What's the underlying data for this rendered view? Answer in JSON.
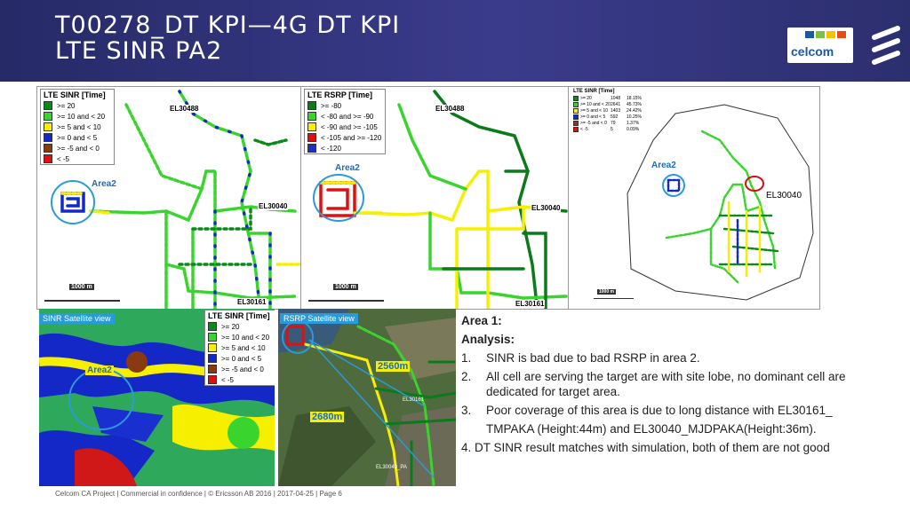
{
  "header": {
    "title_line1": "T00278_DT KPI—4G DT KPI",
    "title_line2": "LTE SINR PA2",
    "celcom_logo_text": "celcom"
  },
  "panel_sinr": {
    "legend_title": "LTE SINR [Time]",
    "legend": [
      {
        "label": ">= 20",
        "color": "#0a8a1a"
      },
      {
        "label": ">= 10 and < 20",
        "color": "#39d42e"
      },
      {
        "label": ">= 5 and < 10",
        "color": "#f6f000"
      },
      {
        "label": ">= 0 and < 5",
        "color": "#1428c8"
      },
      {
        "label": ">= -5 and < 0",
        "color": "#8a3a10"
      },
      {
        "label": "< -5",
        "color": "#e01010"
      }
    ],
    "area_label": "Area2",
    "sites": [
      "EL30488",
      "EL30040",
      "EL30161"
    ],
    "scale": "1000 m"
  },
  "panel_rsrp": {
    "legend_title": "LTE RSRP [Time]",
    "legend": [
      {
        "label": ">= -80",
        "color": "#0a7a1a"
      },
      {
        "label": "< -80 and >= -90",
        "color": "#39d42e"
      },
      {
        "label": "< -90 and >= -105",
        "color": "#f6f000"
      },
      {
        "label": "< -105 and >= -120",
        "color": "#e01010"
      },
      {
        "label": "< -120",
        "color": "#2030c0"
      }
    ],
    "area_label": "Area2",
    "sites": [
      "EL30488",
      "EL30040",
      "EL30161"
    ],
    "scale": "1000 m"
  },
  "panel_stats": {
    "legend_title": "LTE SINR [Time]",
    "rows": [
      {
        "label": ">= 20",
        "count": "1048",
        "pct": "18.15%",
        "color": "#0a8a1a"
      },
      {
        "label": ">= 10 and < 20",
        "count": "2641",
        "pct": "45.73%",
        "color": "#39d42e"
      },
      {
        "label": ">= 5 and < 10",
        "count": "1403",
        "pct": "24.42%",
        "color": "#f6f000"
      },
      {
        "label": ">= 0 and < 5",
        "count": "592",
        "pct": "10.25%",
        "color": "#1428c8"
      },
      {
        "label": ">= -5 and < 0",
        "count": "79",
        "pct": "1.37%",
        "color": "#8a3a10"
      },
      {
        "label": "< -5",
        "count": "5",
        "pct": "0.09%",
        "color": "#e01010"
      }
    ],
    "area_label": "Area2",
    "site": "EL30040",
    "scale": "1000 m"
  },
  "panel_sinr_sat": {
    "tag": "SINR Satellite view",
    "legend_title": "LTE SINR [Time]",
    "legend": [
      {
        "label": ">= 20",
        "color": "#0a8a1a"
      },
      {
        "label": ">= 10 and < 20",
        "color": "#39d42e"
      },
      {
        "label": ">= 5 and < 10",
        "color": "#f6f000"
      },
      {
        "label": ">= 0 and < 5",
        "color": "#1428c8"
      },
      {
        "label": ">= -5 and < 0",
        "color": "#8a3a10"
      },
      {
        "label": "< -5",
        "color": "#e01010"
      }
    ],
    "area_label": "Area2"
  },
  "panel_rsrp_sat": {
    "tag": "RSRP Satellite view",
    "dist1": "2560m",
    "dist2": "2680m",
    "site1": "EL30161",
    "site2": "EL30040_PA"
  },
  "analysis": {
    "heading": "Area 1:",
    "sub": "Analysis:",
    "items": [
      {
        "n": "1.",
        "text": "SINR is bad due to bad RSRP in area 2."
      },
      {
        "n": "2.",
        "text": "All cell are serving the target are with site lobe, no dominant cell are dedicated for target area."
      },
      {
        "n": "3.",
        "text": "Poor coverage of this area is due to long distance with EL30161_"
      },
      {
        "n": "",
        "text": "TMPAKA (Height:44m) and EL30040_MJDPAKA(Height:36m)."
      }
    ],
    "conclusion": "4. DT SINR result matches with simulation, both of them are not good"
  },
  "footer": {
    "text": "Celcom CA Project  |  Commercial in confidence  |  © Ericsson AB 2016  |  2017-04-25  |  Page 6"
  }
}
